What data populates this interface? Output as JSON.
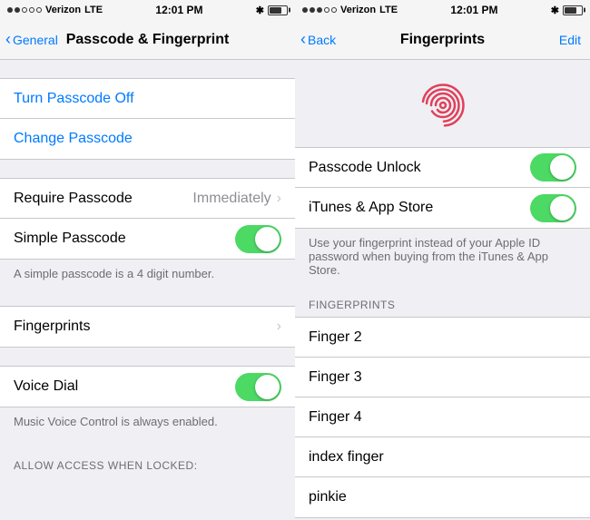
{
  "left_panel": {
    "status_bar": {
      "carrier": "Verizon",
      "network": "LTE",
      "time": "12:01 PM"
    },
    "nav": {
      "back_label": "General",
      "title_plain": "",
      "title_bold": "Passcode & Fingerprint"
    },
    "groups": [
      {
        "id": "passcode-actions",
        "rows": [
          {
            "id": "turn-off",
            "label": "Turn Passcode Off",
            "type": "action"
          },
          {
            "id": "change",
            "label": "Change Passcode",
            "type": "action"
          }
        ]
      },
      {
        "id": "require-simple",
        "rows": [
          {
            "id": "require-passcode",
            "label": "Require Passcode",
            "value": "Immediately",
            "type": "disclosure"
          },
          {
            "id": "simple-passcode",
            "label": "Simple Passcode",
            "type": "toggle",
            "enabled": true
          }
        ]
      },
      {
        "id": "simple-note",
        "note": "A simple passcode is a 4 digit number."
      },
      {
        "id": "fingerprints",
        "rows": [
          {
            "id": "fingerprints-row",
            "label": "Fingerprints",
            "type": "disclosure"
          }
        ]
      },
      {
        "id": "voice-dial",
        "rows": [
          {
            "id": "voice-dial-row",
            "label": "Voice Dial",
            "type": "toggle",
            "enabled": true
          }
        ]
      },
      {
        "id": "voice-note",
        "note": "Music Voice Control is always enabled."
      },
      {
        "id": "allow-access-header",
        "header": "ALLOW ACCESS WHEN LOCKED:"
      }
    ]
  },
  "right_panel": {
    "status_bar": {
      "carrier": "Verizon",
      "network": "LTE",
      "time": "12:01 PM"
    },
    "nav": {
      "back_label": "Back",
      "title": "Fingerprints",
      "action_label": "Edit"
    },
    "toggle_rows": [
      {
        "id": "passcode-unlock",
        "label": "Passcode Unlock",
        "enabled": true
      },
      {
        "id": "itunes-app-store",
        "label": "iTunes & App Store",
        "enabled": true
      }
    ],
    "description": "Use your fingerprint instead of your Apple ID password when buying from the iTunes & App Store.",
    "fingerprints_header": "FINGERPRINTS",
    "fingerprints": [
      {
        "id": "finger-2",
        "label": "Finger 2"
      },
      {
        "id": "finger-3",
        "label": "Finger 3"
      },
      {
        "id": "finger-4",
        "label": "Finger 4"
      },
      {
        "id": "index-finger",
        "label": "index finger"
      },
      {
        "id": "pinkie",
        "label": "pinkie"
      }
    ]
  }
}
